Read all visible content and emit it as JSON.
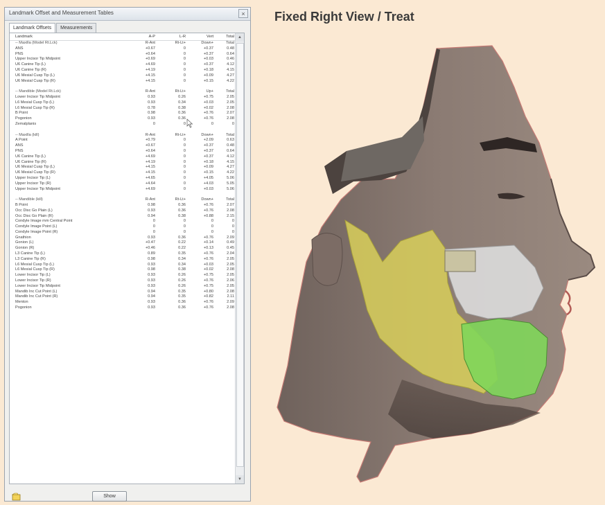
{
  "dialog": {
    "title": "Landmark Offset and Measurement Tables",
    "close_symbol": "×",
    "tabs": [
      {
        "label": "Landmark Offsets",
        "active": true
      },
      {
        "label": "Measurements",
        "active": false
      }
    ],
    "show_button": "Show"
  },
  "table": {
    "headers": [
      "Landmark",
      "A-P",
      "L-R",
      "Vert",
      "Total"
    ],
    "groups": [
      {
        "rows": [
          [
            "-- Maxilla (Model Rt.Lck)",
            "R-Ant",
            "Rt-Lt+",
            "Down+",
            "Total"
          ],
          [
            "ANS",
            "+0.67",
            "0",
            "+0.37",
            "0.48"
          ],
          [
            "PNS",
            "+0.64",
            "0",
            "+0.37",
            "0.64"
          ],
          [
            "Upper Incisor Tip Midpoint",
            "+0.69",
            "0",
            "+0.03",
            "0.46"
          ],
          [
            "U6 Canine Tip (L)",
            "+4.69",
            "0",
            "+0.37",
            "4.12"
          ],
          [
            "U6 Canine Tip (R)",
            "+4.19",
            "0",
            "+0.18",
            "4.15"
          ],
          [
            "U6 Mesial Cusp Tip (L)",
            "+4.15",
            "0",
            "+0.09",
            "4.27"
          ],
          [
            "U6 Mesial Cusp Tip (R)",
            "+4.15",
            "0",
            "+0.15",
            "4.22"
          ]
        ]
      },
      {
        "rows": [
          [
            "-- Mandible (Model Rt.Lck)",
            "R-Ant",
            "Rt-Lt+",
            "Up+",
            "Total"
          ],
          [
            "Lower Incisor Tip Midpoint",
            "0.93",
            "0.26",
            "+0.75",
            "2.05"
          ],
          [
            "L6 Mesial Cusp Tip (L)",
            "0.93",
            "0.34",
            "+0.03",
            "2.05"
          ],
          [
            "L6 Mesial Cusp Tip (R)",
            "0.78",
            "0.38",
            "+0.02",
            "2.08"
          ],
          [
            "B Point",
            "0.98",
            "0.36",
            "+0.76",
            "2.07"
          ],
          [
            "Pogonion",
            "0.93",
            "0.36",
            "+0.76",
            "2.08"
          ],
          [
            "Zemalplanis",
            "0",
            "0",
            "0",
            "0"
          ]
        ]
      },
      {
        "rows": [
          [
            "-- Maxilla (kill)",
            "R-Ant",
            "Rt-Lt+",
            "Down+",
            "Total"
          ],
          [
            "A Point",
            "+0.79",
            "0",
            "+2.09",
            "0.63"
          ],
          [
            "ANS",
            "+0.67",
            "0",
            "+0.37",
            "0.48"
          ],
          [
            "PNS",
            "+0.64",
            "0",
            "+0.37",
            "0.64"
          ],
          [
            "U6 Canine Tip (L)",
            "+4.69",
            "0",
            "+0.37",
            "4.12"
          ],
          [
            "U6 Canine Tip (R)",
            "+4.19",
            "0",
            "+0.18",
            "4.15"
          ],
          [
            "U6 Mesial Cusp Tip (L)",
            "+4.15",
            "0",
            "+0.09",
            "4.27"
          ],
          [
            "U6 Mesial Cusp Tip (R)",
            "+4.15",
            "0",
            "+0.15",
            "4.22"
          ],
          [
            "Upper Incisor Tip (L)",
            "+4.65",
            "0",
            "+4.05",
            "5.06"
          ],
          [
            "Upper Incisor Tip (R)",
            "+4.64",
            "0",
            "+4.03",
            "5.05"
          ],
          [
            "Upper Incisor Tip Midpoint",
            "+4.69",
            "0",
            "+0.03",
            "5.06"
          ]
        ]
      },
      {
        "rows": [
          [
            "-- Mandible (kill)",
            "R-Ant",
            "Rt-Lt+",
            "Down+",
            "Total"
          ],
          [
            "B Point",
            "0.98",
            "0.36",
            "+0.76",
            "2.07"
          ],
          [
            "Occ Disc Go Plain (L)",
            "0.93",
            "0.36",
            "+0.76",
            "2.08"
          ],
          [
            "Occ Disc Go Plain (R)",
            "0.94",
            "0.38",
            "+0.88",
            "2.15"
          ],
          [
            "Condyle Image mm Central Point",
            "0",
            "0",
            "0",
            "0"
          ],
          [
            "Condyle Image Point (L)",
            "0",
            "0",
            "0",
            "0"
          ],
          [
            "Condyle Image Point (R)",
            "0",
            "0",
            "0",
            "0"
          ],
          [
            "Gnathion",
            "0.93",
            "0.36",
            "+0.76",
            "2.09"
          ],
          [
            "Gonion (L)",
            "+0.47",
            "0.22",
            "+0.14",
            "0.49"
          ],
          [
            "Gonion (R)",
            "+0.46",
            "0.22",
            "+0.13",
            "0.45"
          ],
          [
            "L3 Canine Tip (L)",
            "0.89",
            "0.35",
            "+0.76",
            "2.04"
          ],
          [
            "L3 Canine Tip (R)",
            "0.98",
            "0.34",
            "+0.76",
            "2.05"
          ],
          [
            "L6 Mesial Cusp Tip (L)",
            "0.93",
            "0.34",
            "+0.03",
            "2.05"
          ],
          [
            "L6 Mesial Cusp Tip (R)",
            "0.98",
            "0.38",
            "+0.02",
            "2.08"
          ],
          [
            "Lower Incisor Tip (L)",
            "0.93",
            "0.26",
            "+0.75",
            "2.05"
          ],
          [
            "Lower Incisor Tip (R)",
            "0.93",
            "0.26",
            "+0.76",
            "2.06"
          ],
          [
            "Lower Incisor Tip Midpoint",
            "0.93",
            "0.26",
            "+0.75",
            "2.05"
          ],
          [
            "Mandib Inc Cut Point (L)",
            "0.94",
            "0.35",
            "+0.80",
            "2.08"
          ],
          [
            "Mandib Inc Cut Point (R)",
            "0.94",
            "0.35",
            "+0.82",
            "2.11"
          ],
          [
            "Menton",
            "0.93",
            "0.36",
            "+0.76",
            "2.09"
          ],
          [
            "Pogonion",
            "0.93",
            "0.36",
            "+0.76",
            "2.08"
          ]
        ]
      }
    ]
  },
  "view": {
    "title": "Fixed Right View / Treat"
  },
  "colors": {
    "skin": "#8a7a72",
    "mandible_overlay": "#d8cf5a",
    "teeth_overlay": "#7fd65a",
    "background": "#fbe9d3"
  }
}
